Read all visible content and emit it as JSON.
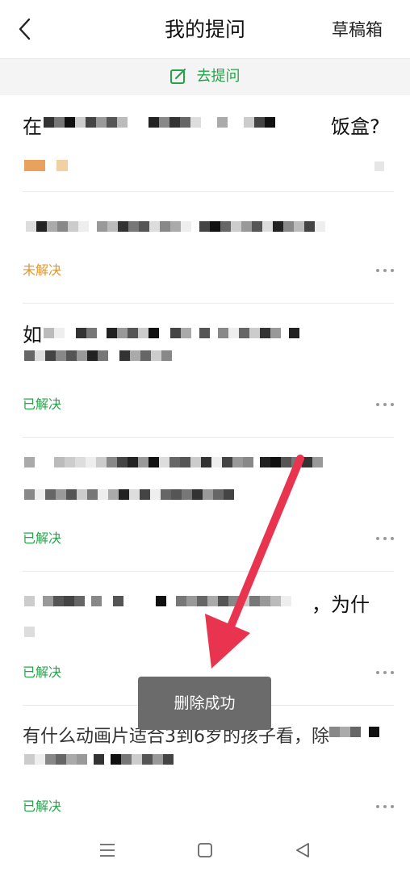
{
  "header": {
    "title": "我的提问",
    "drafts_label": "草稿箱"
  },
  "ask_bar": {
    "label": "去提问"
  },
  "questions": [
    {
      "visible_text": "在",
      "visible_text_end": "饭盒?",
      "status": ""
    },
    {
      "visible_text": "",
      "visible_text_end": "",
      "status": "未解决"
    },
    {
      "visible_text": "如",
      "visible_text_end": "",
      "status": "已解决"
    },
    {
      "visible_text": "",
      "visible_text_end": "",
      "status": "已解决"
    },
    {
      "visible_text": "",
      "visible_text_end": "，为什",
      "status": "已解决"
    },
    {
      "visible_text": "有什么动画片适合3到6岁的孩子看，除",
      "visible_text_end": "",
      "status": "已解决"
    }
  ],
  "toast": {
    "message": "删除成功"
  },
  "colors": {
    "accent_green": "#27a24a",
    "pending_orange": "#e2962c",
    "annotation_arrow": "#e8344e",
    "toast_bg": "#6b6b6b"
  },
  "icons": {
    "back": "chevron-left-icon",
    "edit": "edit-icon",
    "more": "more-dots-icon",
    "nav_menu": "menu-lines-icon",
    "nav_home": "square-icon",
    "nav_back": "triangle-back-icon"
  }
}
